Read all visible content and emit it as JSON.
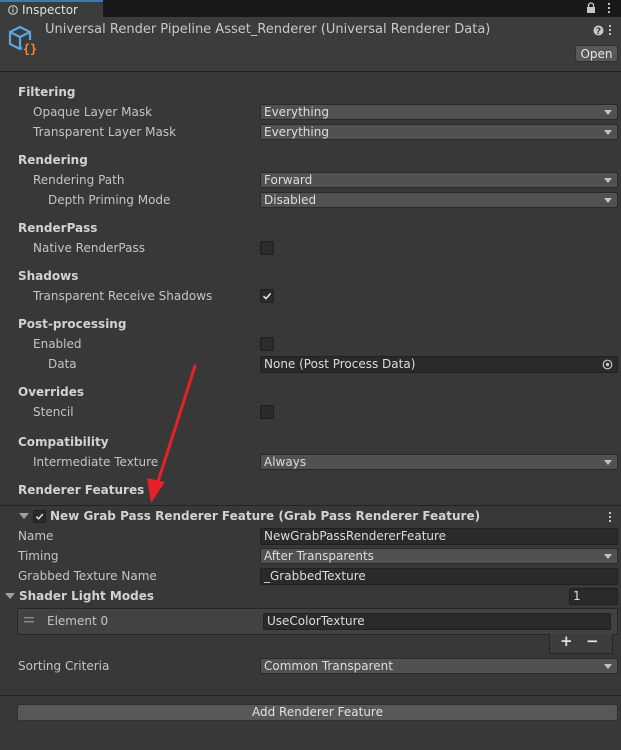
{
  "tab": {
    "label": "Inspector"
  },
  "header": {
    "title": "Universal Render Pipeline Asset_Renderer (Universal Renderer Data)",
    "open_label": "Open"
  },
  "filtering": {
    "heading": "Filtering",
    "opaque_label": "Opaque Layer Mask",
    "opaque_value": "Everything",
    "transparent_label": "Transparent Layer Mask",
    "transparent_value": "Everything"
  },
  "rendering": {
    "heading": "Rendering",
    "path_label": "Rendering Path",
    "path_value": "Forward",
    "depth_label": "Depth Priming Mode",
    "depth_value": "Disabled"
  },
  "renderpass": {
    "heading": "RenderPass",
    "native_label": "Native RenderPass",
    "native_checked": false
  },
  "shadows": {
    "heading": "Shadows",
    "receive_label": "Transparent Receive Shadows",
    "receive_checked": true
  },
  "postprocessing": {
    "heading": "Post-processing",
    "enabled_label": "Enabled",
    "enabled_checked": false,
    "data_label": "Data",
    "data_value": "None (Post Process Data)"
  },
  "overrides": {
    "heading": "Overrides",
    "stencil_label": "Stencil",
    "stencil_checked": false
  },
  "compatibility": {
    "heading": "Compatibility",
    "intermediate_label": "Intermediate Texture",
    "intermediate_value": "Always"
  },
  "renderer_features": {
    "heading": "Renderer Features",
    "feature": {
      "title": "New Grab Pass Renderer Feature (Grab Pass Renderer Feature)",
      "enabled": true,
      "name_label": "Name",
      "name_value": "NewGrabPassRendererFeature",
      "timing_label": "Timing",
      "timing_value": "After Transparents",
      "grabbed_label": "Grabbed Texture Name",
      "grabbed_value": "_GrabbedTexture",
      "shader_modes_label": "Shader Light Modes",
      "shader_modes_count": "1",
      "element_label": "Element 0",
      "element_value": "UseColorTexture",
      "plus": "+",
      "minus": "−",
      "sorting_label": "Sorting Criteria",
      "sorting_value": "Common Transparent"
    },
    "add_label": "Add Renderer Feature"
  },
  "colors": {
    "background": "#383838",
    "annotation_arrow": "#e8202a",
    "tab_accent": "#3a79bb"
  }
}
